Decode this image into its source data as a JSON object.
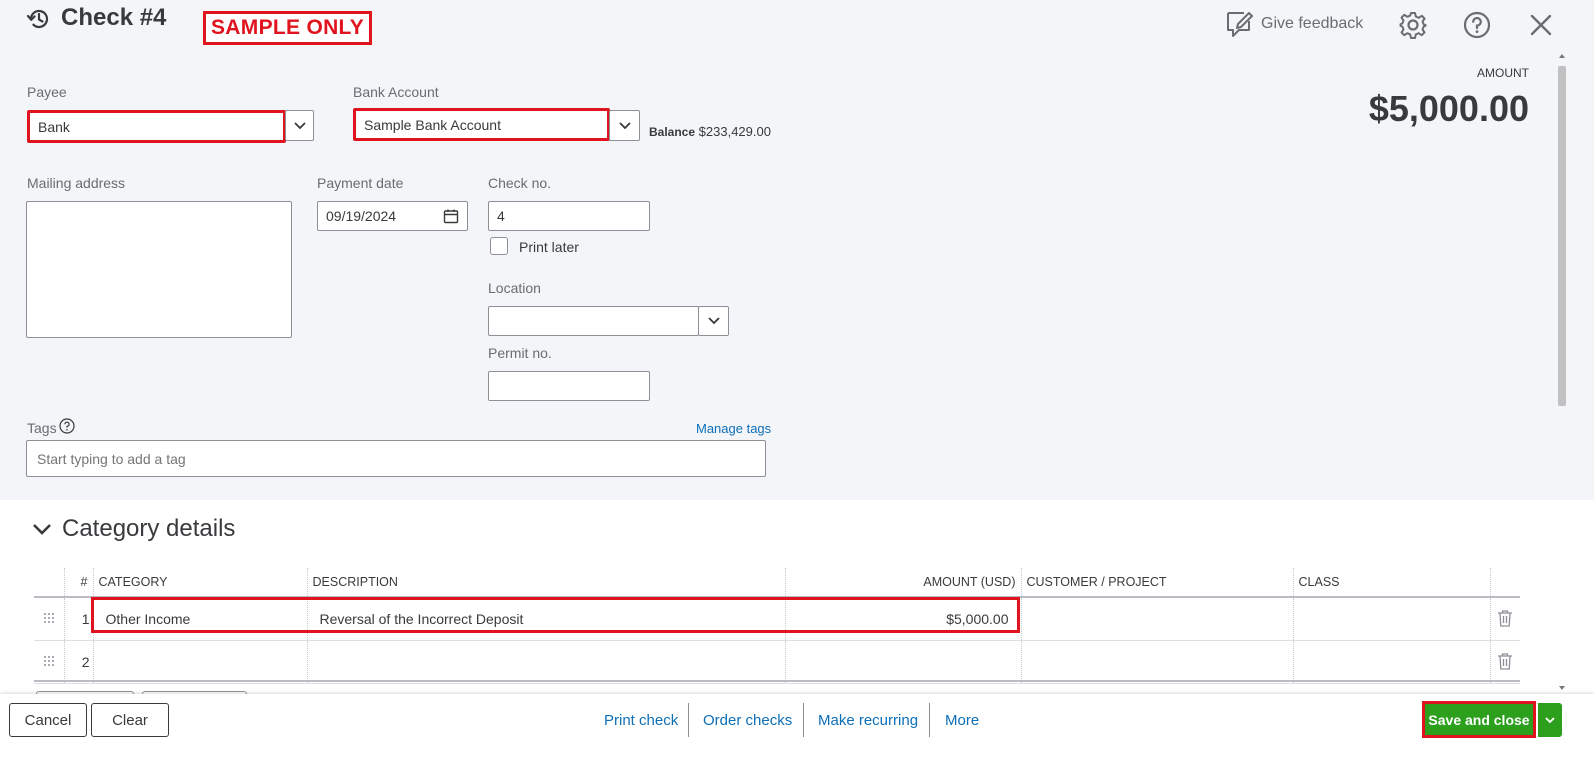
{
  "header": {
    "title": "Check #4",
    "sample_badge": "SAMPLE ONLY",
    "feedback_label": "Give feedback",
    "amount_label": "AMOUNT",
    "amount_value": "$5,000.00"
  },
  "form": {
    "payee_label": "Payee",
    "payee_value": "Bank",
    "bank_account_label": "Bank Account",
    "bank_account_value": "Sample Bank Account",
    "balance_label": "Balance",
    "balance_value": "$233,429.00",
    "mailing_address_label": "Mailing address",
    "payment_date_label": "Payment date",
    "payment_date_value": "09/19/2024",
    "check_no_label": "Check no.",
    "check_no_value": "4",
    "print_later_label": "Print later",
    "location_label": "Location",
    "permit_no_label": "Permit no.",
    "tags_label": "Tags",
    "manage_tags_label": "Manage tags",
    "tags_placeholder": "Start typing to add a tag"
  },
  "category_details": {
    "title": "Category details",
    "columns": [
      "#",
      "CATEGORY",
      "DESCRIPTION",
      "AMOUNT (USD)",
      "CUSTOMER / PROJECT",
      "CLASS"
    ],
    "rows": [
      {
        "num": "1",
        "category": "Other Income",
        "description": "Reversal of the Incorrect Deposit",
        "amount": "$5,000.00",
        "customer": "",
        "class": ""
      },
      {
        "num": "2",
        "category": "",
        "description": "",
        "amount": "",
        "customer": "",
        "class": ""
      }
    ]
  },
  "footer": {
    "cancel_label": "Cancel",
    "clear_label": "Clear",
    "print_check_label": "Print check",
    "order_checks_label": "Order checks",
    "make_recurring_label": "Make recurring",
    "more_label": "More",
    "save_close_label": "Save and close"
  },
  "colors": {
    "highlight": "#e0141e",
    "link": "#0d6fb8",
    "primary_button": "#2ca01c",
    "top_background": "#f4f5f8"
  }
}
